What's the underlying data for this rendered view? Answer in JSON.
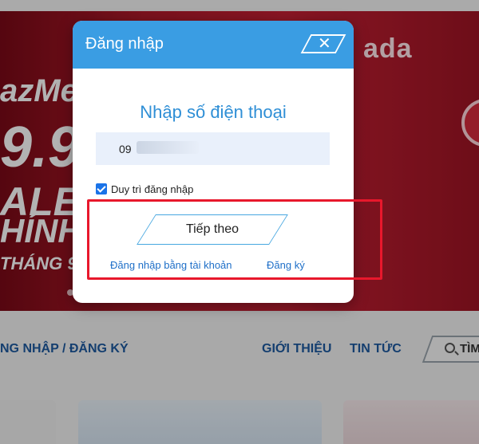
{
  "banner": {
    "brand": "ada",
    "lazme": "azMe",
    "big": "9.9",
    "sale": "ALE",
    "chinh": "HÍNH",
    "thang": "THÁNG 9"
  },
  "nav": {
    "login_register": "NG NHẬP / ĐĂNG KÝ",
    "about": "GIỚI THIỆU",
    "news": "TIN TỨC",
    "search_label": "TÌM"
  },
  "modal": {
    "title": "Đăng nhập",
    "close_icon": "close-x",
    "heading": "Nhập số điện thoại",
    "phone_value": "09",
    "remember_label": "Duy trì đăng nhập",
    "remember_checked": true,
    "next_button": "Tiếp theo",
    "login_account_link": "Đăng nhập bằng tài khoản",
    "register_link": "Đăng ký"
  },
  "colors": {
    "header_blue": "#3a9de3",
    "heading_blue": "#2f8fd6",
    "highlight_red": "#e8182c",
    "banner_red": "#c52034"
  }
}
